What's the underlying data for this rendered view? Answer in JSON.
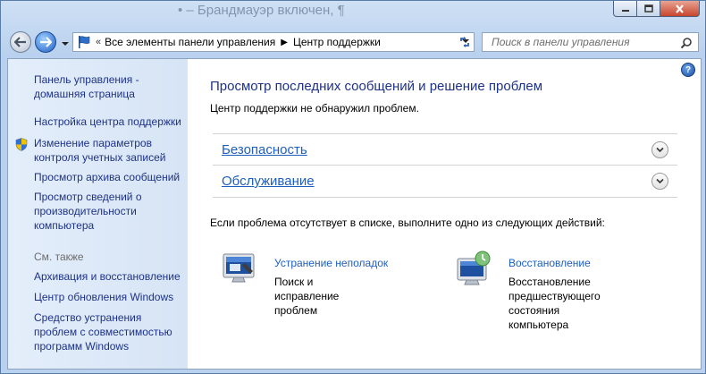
{
  "window": {
    "title_partial": "• – Брандмауэр включен, ¶"
  },
  "address_bar": {
    "overflow_chevron": "«",
    "crumbs": [
      "Все элементы панели управления",
      "Центр поддержки"
    ],
    "separator": "▶"
  },
  "search": {
    "placeholder": "Поиск в панели управления"
  },
  "sidebar": {
    "links": [
      "Панель управления -\nдомашняя страница",
      "Настройка центра поддержки",
      "Изменение параметров\nконтроля учетных записей",
      "Просмотр архива сообщений",
      "Просмотр сведений о\nпроизводительности\nкомпьютера"
    ],
    "see_also_heading": "См. также",
    "see_also": [
      "Архивация и восстановление",
      "Центр обновления Windows",
      "Средство устранения\nпроблем с совместимостью\nпрограмм Windows"
    ]
  },
  "main": {
    "help_glyph": "?",
    "heading": "Просмотр последних сообщений и решение проблем",
    "status": "Центр поддержки не обнаружил проблем.",
    "sections": [
      "Безопасность",
      "Обслуживание"
    ],
    "hint": "Если проблема отсутствует в списке, выполните одно из следующих действий:",
    "actions": [
      {
        "link": "Устранение неполадок",
        "desc": "Поиск и исправление проблем",
        "icon": "troubleshooting-icon"
      },
      {
        "link": "Восстановление",
        "desc": "Восстановление\nпредшествующего\nсостояния компьютера",
        "icon": "system-restore-icon"
      }
    ]
  },
  "colors": {
    "link": "#1e3287",
    "section_link": "#1e5fbd",
    "sidebar_bg": "#dce8f7",
    "frame": "#b9d1ee"
  }
}
